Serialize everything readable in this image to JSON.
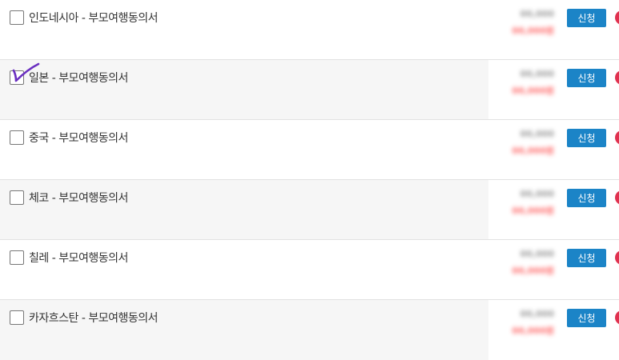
{
  "items": [
    {
      "label": "인도네시아 - 부모여행동의서",
      "price": "00,000",
      "sale": "00,000원",
      "button": "신청",
      "checked": false
    },
    {
      "label": "일본 - 부모여행동의서",
      "price": "00,000",
      "sale": "00,000원",
      "button": "신청",
      "checked": true
    },
    {
      "label": "중국 - 부모여행동의서",
      "price": "00,000",
      "sale": "00,000원",
      "button": "신청",
      "checked": false
    },
    {
      "label": "체코 - 부모여행동의서",
      "price": "00,000",
      "sale": "00,000원",
      "button": "신청",
      "checked": false
    },
    {
      "label": "칠레 - 부모여행동의서",
      "price": "00,000",
      "sale": "00,000원",
      "button": "신청",
      "checked": false
    },
    {
      "label": "카자흐스탄 - 부모여행동의서",
      "price": "00,000",
      "sale": "00,000원",
      "button": "신청",
      "checked": false
    }
  ],
  "colors": {
    "button": "#1b84c7",
    "sale": "#ff3b3b",
    "indicator": "#e0314f",
    "annotation": "#6a2fc0"
  },
  "icons": {
    "annotation": "handwritten-checkmark-icon"
  }
}
